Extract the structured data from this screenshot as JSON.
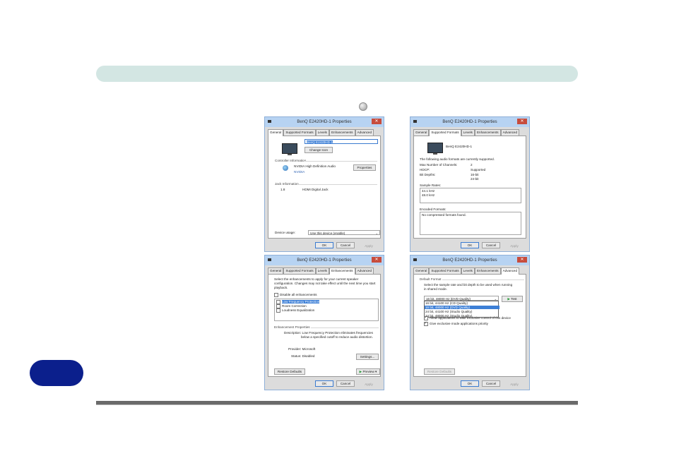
{
  "dialog_title_1": "BenQ E2420HD-1 Properties",
  "dialog_title_2": "BenQ E2420HD-1 Properties",
  "dialog_title_3": "BenQ E2420HD-1 Properties",
  "dialog_title_4": "BenQ E2420HD-1 Properties",
  "tabs": {
    "general": "General",
    "supported": "Supported Formats",
    "levels": "Levels",
    "enhancements": "Enhancements",
    "advanced": "Advanced"
  },
  "footer": {
    "ok": "OK",
    "cancel": "Cancel",
    "apply": "Apply"
  },
  "general": {
    "device_name": "BenQ E2420HD-1",
    "change_icon": "Change Icon",
    "controller_group": "Controller Information",
    "controller_name": "NVIDIA High Definition Audio",
    "controller_vendor": "NVIDIA",
    "properties_button": "Properties",
    "jack_group": "Jack Information",
    "jack_id": "1.8",
    "jack_name": "HDMI Digital Jack",
    "device_usage_label": "Device usage:",
    "device_usage_value": "Use this device (enable)"
  },
  "supported": {
    "device_name": "BenQ E2420HD-1",
    "intro": "The following audio formats are currently supported.",
    "max_channels_label": "Max Number of Channels:",
    "max_channels_value": "2",
    "hdcp_label": "HDCP:",
    "hdcp_value": "Supported",
    "bit_depths_label": "Bit Depths:",
    "bit_depth_1": "16-bit",
    "bit_depth_2": "24-bit",
    "sample_rates_label": "Sample Rates:",
    "rate_1": "44.1 kHz",
    "rate_2": "48.0 kHz",
    "encoded_label": "Encoded Formats:",
    "encoded_value": "No compressed formats found."
  },
  "enhancements": {
    "intro_1": "Select the enhancements to apply for your current speaker",
    "intro_2": "configuration. Changes may not take effect until the next time you start",
    "intro_3": "playback.",
    "disable_all": "Disable all enhancements",
    "item_1": "Low Frequency Protection",
    "item_2": "Room Correction",
    "item_3": "Loudness Equalization",
    "props_group": "Enhancement Properties",
    "description_1": "Description: Low Frequency Protection eliminates frequencies",
    "description_2": "below a specified cutoff to reduce audio distortion.",
    "provider": "Provider: Microsoft",
    "status": "Status: Disabled",
    "settings_button": "Settings...",
    "restore_button": "Restore Defaults",
    "preview_button": "Preview"
  },
  "advanced": {
    "group": "Default Format",
    "intro_1": "Select the sample rate and bit depth to be used when running",
    "intro_2": "in shared mode.",
    "selected": "16 bit, 48000 Hz (DVD Quality)",
    "option_1": "16 bit, 44100 Hz (CD Quality)",
    "option_2": "16 bit, 48000 Hz (DVD Quality)",
    "option_3": "24 bit, 44100 Hz (Studio Quality)",
    "option_4": "24 bit, 48000 Hz (Studio Quality)",
    "test_button": "Test",
    "exclusive_1": "Allow applications to take exclusive control of this device",
    "exclusive_2": "Give exclusive mode applications priority",
    "restore_button": "Restore Defaults"
  }
}
